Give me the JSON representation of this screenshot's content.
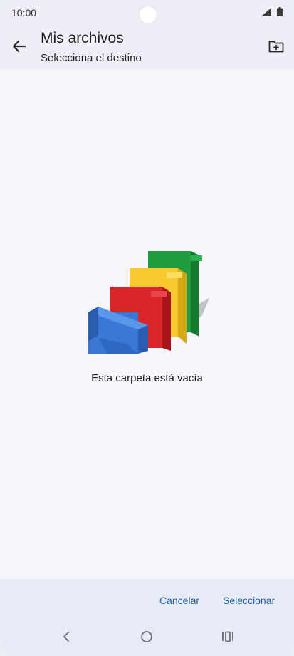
{
  "status_bar": {
    "time": "10:00",
    "icons": [
      "signal-icon",
      "battery-icon"
    ]
  },
  "app_bar": {
    "title": "Mis archivos",
    "subtitle": "Selecciona el destino",
    "back_icon": "arrow-left-icon",
    "new_folder_icon": "new-folder-icon"
  },
  "empty_state": {
    "illustration": "folders-illustration",
    "message": "Esta carpeta está vacía"
  },
  "actions": {
    "cancel_label": "Cancelar",
    "select_label": "Seleccionar"
  },
  "nav_bar": {
    "icons": [
      "nav-back-icon",
      "nav-home-icon",
      "nav-recents-icon"
    ]
  },
  "colors": {
    "accent": "#1c5fa5",
    "folder_blue": "#3b78d6",
    "folder_red": "#d9262a",
    "folder_yellow": "#f7cb2e",
    "folder_green": "#1f9c3f"
  }
}
